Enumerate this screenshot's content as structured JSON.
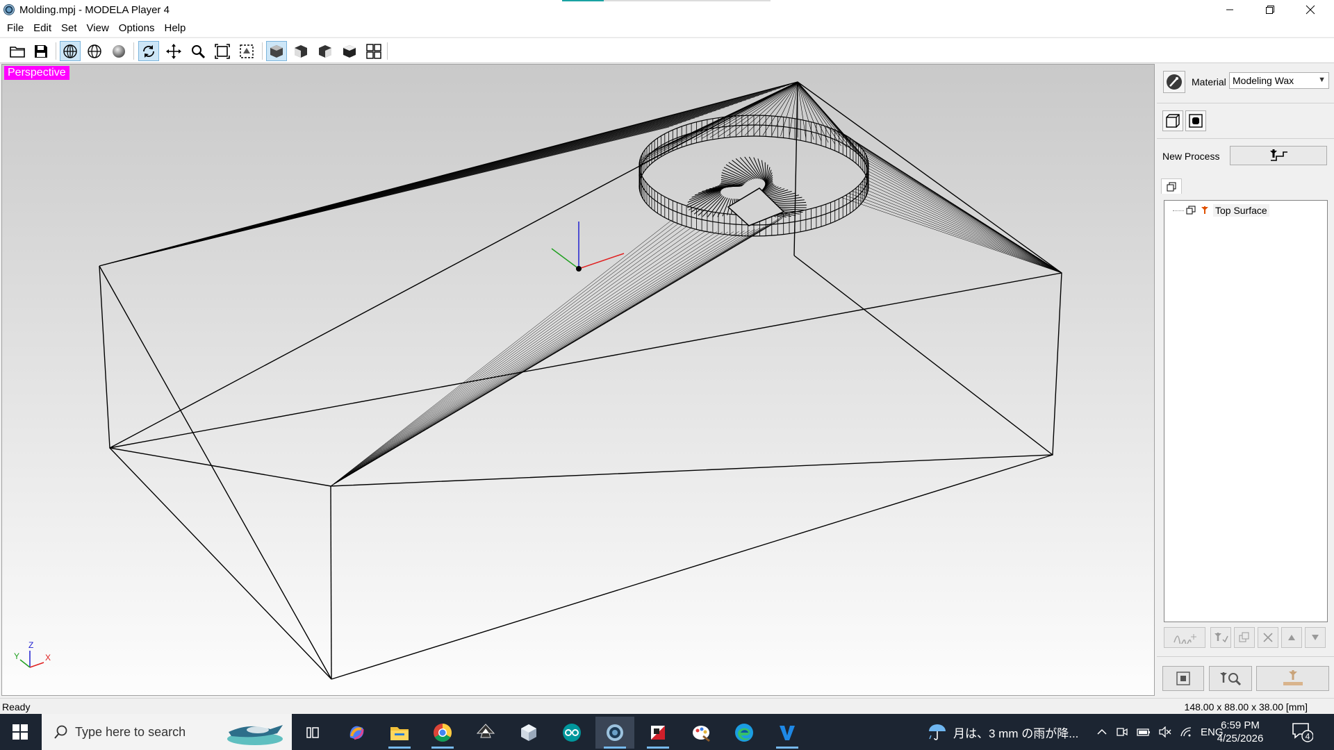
{
  "window": {
    "title": "Molding.mpj - MODELA Player 4",
    "controls": [
      "minimize-icon",
      "restore-icon",
      "close-icon"
    ]
  },
  "menu": [
    "File",
    "Edit",
    "Set",
    "View",
    "Options",
    "Help"
  ],
  "toolbar": {
    "buttons": [
      "open-folder-icon",
      "save-icon",
      "wireframe-icon",
      "hidden-line-icon",
      "shaded-icon",
      "rotate-icon",
      "pan-icon",
      "zoom-icon",
      "fit-icon",
      "zoom-selection-icon",
      "view-iso-icon",
      "view-front-icon",
      "view-right-icon",
      "view-top-icon",
      "view-quad-icon"
    ]
  },
  "viewport": {
    "view_label": "Perspective",
    "mini_axis": {
      "z": "Z",
      "y": "Y",
      "x": "X"
    },
    "colors": {
      "label_bg": "#ff00ff",
      "axis_x": "#e02020",
      "axis_y": "#20a020",
      "axis_z": "#2020d0"
    }
  },
  "panel": {
    "material_label": "Material",
    "material_value": "Modeling Wax",
    "new_process_label": "New Process",
    "process_tree": [
      {
        "label": "Top Surface"
      }
    ]
  },
  "status": {
    "left": "Ready",
    "right": "148.00 x 88.00 x 38.00 [mm]"
  },
  "taskbar": {
    "search_placeholder": "Type here to search",
    "weather_text": "月は、3 mm の雨が降...",
    "language": "ENG",
    "time": "6:59 PM",
    "date": "4/25/2026",
    "notification_count": "4",
    "apps": [
      "task-view-icon",
      "copilot-icon",
      "file-explorer-icon",
      "chrome-icon",
      "inkscape-icon",
      "3d-viewer-icon",
      "arduino-icon",
      "modela-player-icon",
      "roland-icon",
      "paint-icon",
      "edge-icon",
      "vpanel-icon"
    ]
  }
}
